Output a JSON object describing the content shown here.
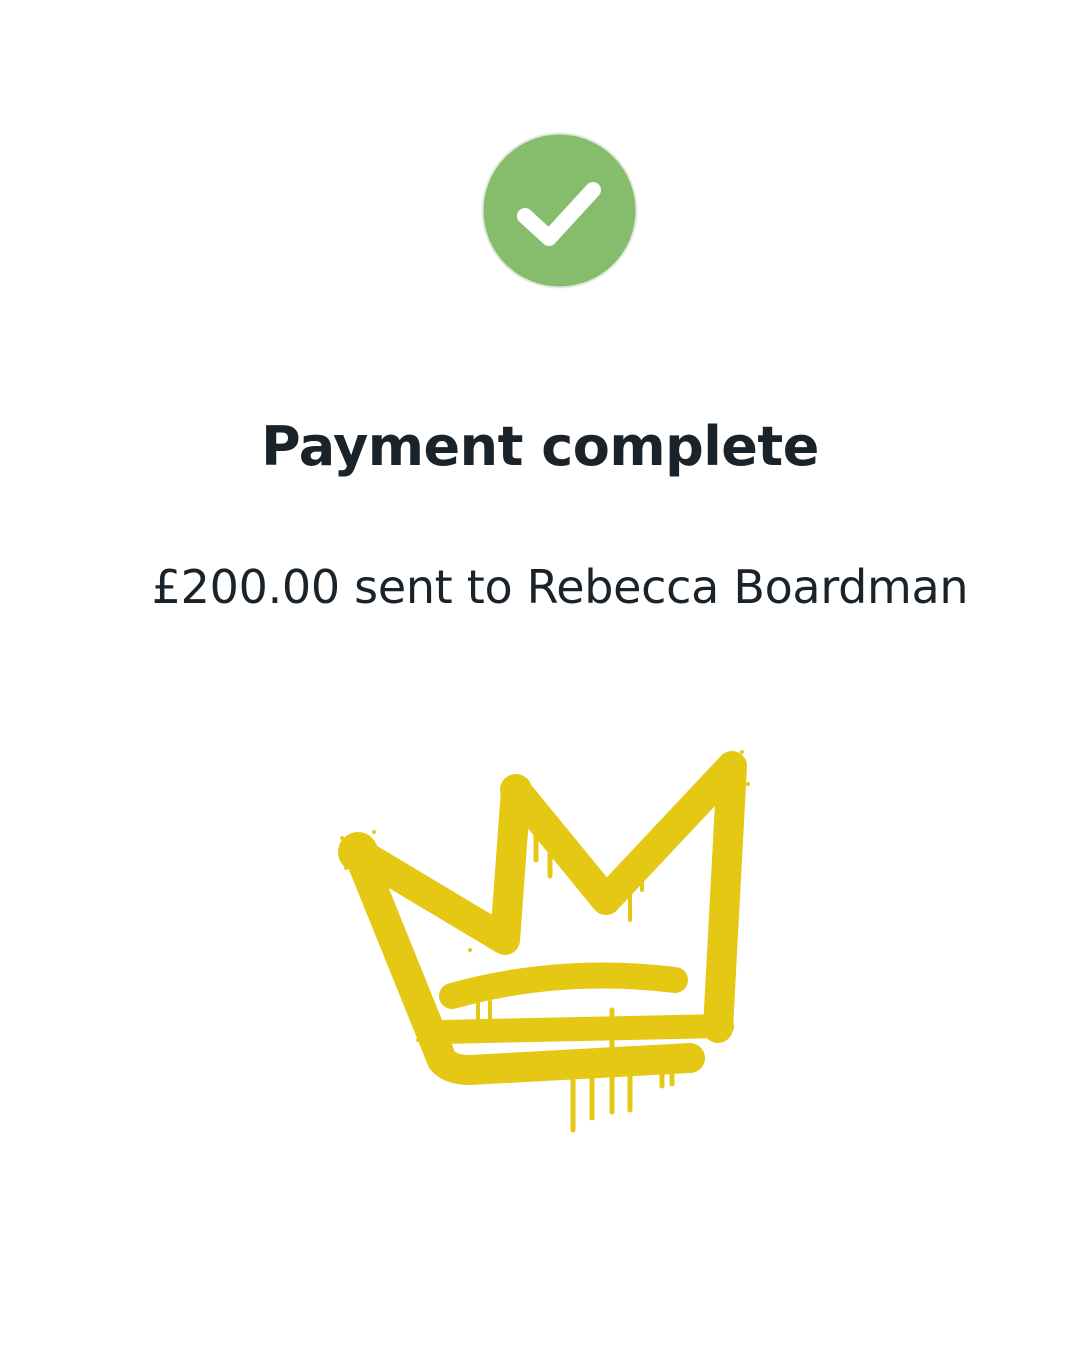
{
  "confirmation": {
    "icon": "check-circle-icon",
    "title": "Payment complete",
    "message": "£200.00 sent to Rebecca Boardman"
  },
  "decoration": {
    "icon": "graffiti-crown-icon"
  },
  "colors": {
    "background": "#ffffff",
    "success_green": "#86bd6c",
    "check_white": "#ffffff",
    "text_dark": "#1b232a",
    "crown_yellow": "#e5c814"
  }
}
